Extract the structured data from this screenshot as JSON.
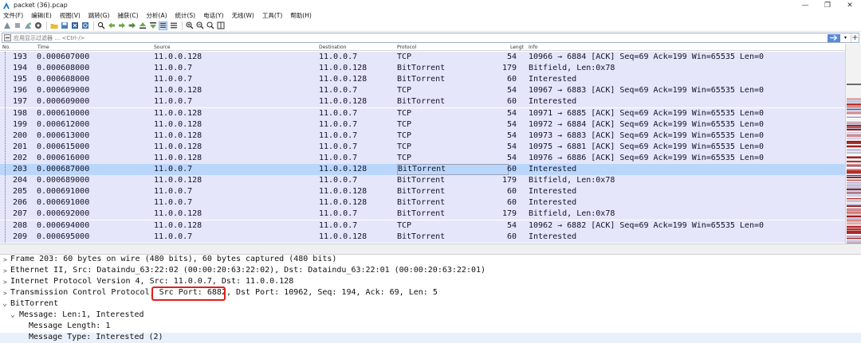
{
  "window": {
    "title": "packet (36).pcap",
    "controls": [
      "—",
      "❐",
      "✕"
    ]
  },
  "menu": [
    "文件(F)",
    "编辑(E)",
    "视图(V)",
    "跳转(G)",
    "捕获(C)",
    "分析(A)",
    "统计(S)",
    "电话(Y)",
    "无线(W)",
    "工具(T)",
    "帮助(H)"
  ],
  "filter": {
    "placeholder": "应用显示过滤器 … <Ctrl-/>",
    "value": ""
  },
  "columns": {
    "no": "No.",
    "time": "Time",
    "source": "Source",
    "destination": "Destination",
    "protocol": "Protocol",
    "length": "Lengt",
    "info": "Info"
  },
  "packets": [
    {
      "no": "193",
      "time": "0.000607000",
      "src": "11.0.0.128",
      "dst": "11.0.0.7",
      "proto": "TCP",
      "len": "54",
      "info": "10966 → 6884 [ACK] Seq=69 Ack=199 Win=65535 Len=0"
    },
    {
      "no": "194",
      "time": "0.000608000",
      "src": "11.0.0.7",
      "dst": "11.0.0.128",
      "proto": "BitTorrent",
      "len": "179",
      "info": "Bitfield, Len:0x78"
    },
    {
      "no": "195",
      "time": "0.000608000",
      "src": "11.0.0.7",
      "dst": "11.0.0.128",
      "proto": "BitTorrent",
      "len": "60",
      "info": "Interested"
    },
    {
      "no": "196",
      "time": "0.000609000",
      "src": "11.0.0.128",
      "dst": "11.0.0.7",
      "proto": "TCP",
      "len": "54",
      "info": "10967 → 6883 [ACK] Seq=69 Ack=199 Win=65535 Len=0"
    },
    {
      "no": "197",
      "time": "0.000609000",
      "src": "11.0.0.7",
      "dst": "11.0.0.128",
      "proto": "BitTorrent",
      "len": "60",
      "info": "Interested"
    },
    {
      "no": "198",
      "time": "0.000610000",
      "src": "11.0.0.128",
      "dst": "11.0.0.7",
      "proto": "TCP",
      "len": "54",
      "info": "10971 → 6885 [ACK] Seq=69 Ack=199 Win=65535 Len=0"
    },
    {
      "no": "199",
      "time": "0.000612000",
      "src": "11.0.0.128",
      "dst": "11.0.0.7",
      "proto": "TCP",
      "len": "54",
      "info": "10972 → 6884 [ACK] Seq=69 Ack=199 Win=65535 Len=0"
    },
    {
      "no": "200",
      "time": "0.000613000",
      "src": "11.0.0.128",
      "dst": "11.0.0.7",
      "proto": "TCP",
      "len": "54",
      "info": "10973 → 6883 [ACK] Seq=69 Ack=199 Win=65535 Len=0"
    },
    {
      "no": "201",
      "time": "0.000615000",
      "src": "11.0.0.128",
      "dst": "11.0.0.7",
      "proto": "TCP",
      "len": "54",
      "info": "10975 → 6881 [ACK] Seq=69 Ack=199 Win=65535 Len=0"
    },
    {
      "no": "202",
      "time": "0.000616000",
      "src": "11.0.0.128",
      "dst": "11.0.0.7",
      "proto": "TCP",
      "len": "54",
      "info": "10976 → 6886 [ACK] Seq=69 Ack=199 Win=65535 Len=0"
    },
    {
      "no": "203",
      "time": "0.000687000",
      "src": "11.0.0.7",
      "dst": "11.0.0.128",
      "proto": "BitTorrent",
      "len": "60",
      "info": "Interested",
      "selected": true
    },
    {
      "no": "204",
      "time": "0.000689000",
      "src": "11.0.0.128",
      "dst": "11.0.0.7",
      "proto": "BitTorrent",
      "len": "179",
      "info": "Bitfield, Len:0x78"
    },
    {
      "no": "205",
      "time": "0.000691000",
      "src": "11.0.0.7",
      "dst": "11.0.0.128",
      "proto": "BitTorrent",
      "len": "60",
      "info": "Interested"
    },
    {
      "no": "206",
      "time": "0.000691000",
      "src": "11.0.0.7",
      "dst": "11.0.0.128",
      "proto": "BitTorrent",
      "len": "60",
      "info": "Interested"
    },
    {
      "no": "207",
      "time": "0.000692000",
      "src": "11.0.0.128",
      "dst": "11.0.0.7",
      "proto": "BitTorrent",
      "len": "179",
      "info": "Bitfield, Len:0x78"
    },
    {
      "no": "208",
      "time": "0.000694000",
      "src": "11.0.0.128",
      "dst": "11.0.0.7",
      "proto": "TCP",
      "len": "54",
      "info": "10962 → 6882 [ACK] Seq=69 Ack=199 Win=65535 Len=0"
    },
    {
      "no": "209",
      "time": "0.000695000",
      "src": "11.0.0.7",
      "dst": "11.0.0.128",
      "proto": "BitTorrent",
      "len": "60",
      "info": "Interested"
    }
  ],
  "details": [
    {
      "arrow": ">",
      "indent": 0,
      "text": "Frame 203: 60 bytes on wire (480 bits), 60 bytes captured (480 bits)"
    },
    {
      "arrow": ">",
      "indent": 0,
      "text": "Ethernet II, Src: Dataindu_63:22:02 (00:00:20:63:22:02), Dst: Dataindu_63:22:01 (00:00:20:63:22:01)"
    },
    {
      "arrow": ">",
      "indent": 0,
      "text": "Internet Protocol Version 4, Src: 11.0.0.7, Dst: 11.0.0.128"
    },
    {
      "arrow": ">",
      "indent": 0,
      "text_before": "Transmission Control Protocol, ",
      "text_boxed": "Src Port: 6882",
      "text_after": ", Dst Port: 10962, Seq: 194, Ack: 69, Len: 5"
    },
    {
      "arrow": "⌄",
      "indent": 0,
      "text": "BitTorrent"
    },
    {
      "arrow": "⌄",
      "indent": 1,
      "text": "Message: Len:1, Interested"
    },
    {
      "arrow": "",
      "indent": 2,
      "text": "Message Length: 1"
    },
    {
      "arrow": "",
      "indent": 2,
      "text": "Message Type: Interested (2)",
      "highlight": true
    }
  ],
  "colors": {
    "row_bg": "#e6e6fa",
    "row_selected": "#bad6fb",
    "annotation": "#e0201c"
  }
}
